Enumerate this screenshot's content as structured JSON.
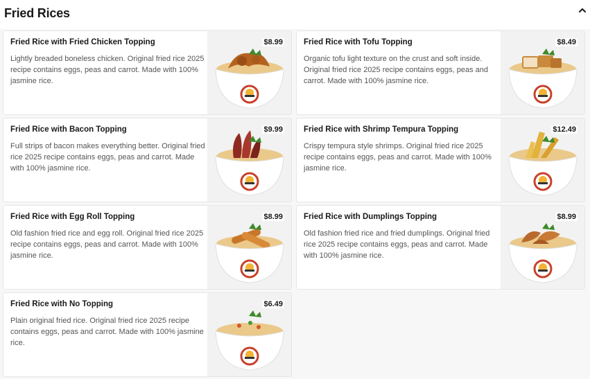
{
  "section": {
    "title": "Fried Rices",
    "collapse_icon": "chevron-up-icon"
  },
  "items": [
    {
      "name": "Fried Rice with Fried Chicken Topping",
      "price": "$8.99",
      "description": "Lightly breaded boneless chicken. Original fried rice 2025 recipe contains eggs, peas and carrot. Made with 100% jasmine rice.",
      "topping": "fried-chicken",
      "topping_color": "#b5621f"
    },
    {
      "name": "Fried Rice with Tofu Topping",
      "price": "$8.49",
      "description": "Organic tofu light texture on the crust and soft inside. Original fried rice 2025 recipe contains eggs, peas and carrot. Made with 100% jasmine rice.",
      "topping": "tofu",
      "topping_color": "#c98a3d"
    },
    {
      "name": "Fried Rice with Bacon Topping",
      "price": "$9.99",
      "description": "Full strips of bacon makes everything better. Original fried rice 2025 recipe contains eggs, peas and carrot. Made with 100% jasmine rice.",
      "topping": "bacon",
      "topping_color": "#8e2a22"
    },
    {
      "name": "Fried Rice with Shrimp Tempura Topping",
      "price": "$12.49",
      "description": "Crispy tempura style shrimps. Original fried rice 2025 recipe contains eggs, peas and carrot. Made with 100% jasmine rice.",
      "topping": "shrimp-tempura",
      "topping_color": "#e3b23c"
    },
    {
      "name": "Fried Rice with Egg Roll Topping",
      "price": "$8.99",
      "description": "Old fashion fried rice and egg roll. Original fried rice 2025 recipe contains eggs, peas and carrot. Made with 100% jasmine rice.",
      "topping": "egg-roll",
      "topping_color": "#c8762a"
    },
    {
      "name": "Fried Rice with Dumplings Topping",
      "price": "$8.99",
      "description": "Old fashion fried rice and fried dumplings. Original fried rice 2025 recipe contains eggs, peas and carrot. Made with 100% jasmine rice.",
      "topping": "dumplings",
      "topping_color": "#b86a2e"
    },
    {
      "name": "Fried Rice with No Topping",
      "price": "$6.49",
      "description": "Plain original fried rice. Original fried rice 2025 recipe contains eggs, peas and carrot. Made with 100% jasmine rice.",
      "topping": "none",
      "topping_color": "#e8c27a"
    }
  ],
  "colors": {
    "bowl": "#ffffff",
    "rice": "#eac98a",
    "logo_ring": "#c8402a",
    "logo_sun": "#f2b233",
    "garnish": "#3e8a2b"
  }
}
